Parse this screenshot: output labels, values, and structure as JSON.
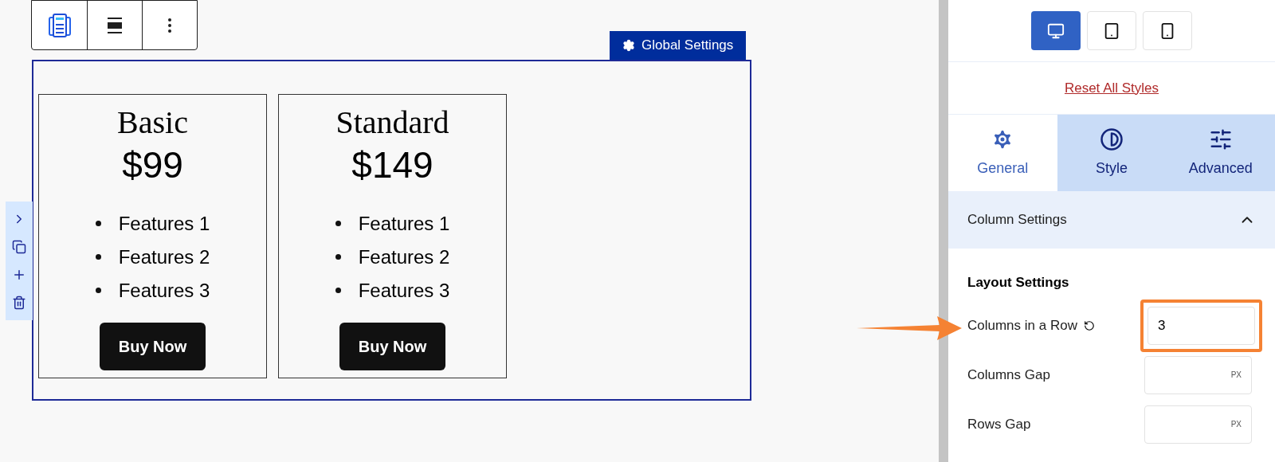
{
  "block_toolbar": {
    "buttons": [
      {
        "kind": "block"
      },
      {
        "kind": "align"
      },
      {
        "kind": "more"
      }
    ]
  },
  "global_settings": {
    "label": "Global Settings"
  },
  "cards": [
    {
      "title": "Basic",
      "price": "$99",
      "features": [
        "Features 1",
        "Features 2",
        "Features 3"
      ],
      "button": "Buy Now"
    },
    {
      "title": "Standard",
      "price": "$149",
      "features": [
        "Features 1",
        "Features 2",
        "Features 3"
      ],
      "button": "Buy Now"
    }
  ],
  "side_toolbar": [
    {
      "kind": "expand"
    },
    {
      "kind": "copy"
    },
    {
      "kind": "add"
    },
    {
      "kind": "delete"
    }
  ],
  "sidebar": {
    "devices": [
      {
        "kind": "desktop",
        "selected": true
      },
      {
        "kind": "tablet",
        "selected": false
      },
      {
        "kind": "mobile",
        "selected": false
      }
    ],
    "reset_link": "Reset All Styles",
    "tabs": [
      {
        "kind": "general",
        "label": "General",
        "selected": true
      },
      {
        "kind": "style",
        "label": "Style",
        "selected": false
      },
      {
        "kind": "advanced",
        "label": "Advanced",
        "selected": false
      }
    ],
    "section": {
      "title": "Column Settings",
      "expanded": true
    },
    "group_title": "Layout Settings",
    "fields": [
      {
        "label": "Columns in a Row",
        "value": "3",
        "resettable": true,
        "highlighted": true
      },
      {
        "label": "Columns Gap",
        "unit": "PX",
        "resettable": false,
        "highlighted": false
      },
      {
        "label": "Rows Gap",
        "unit": "PX",
        "resettable": false,
        "highlighted": false
      }
    ]
  }
}
